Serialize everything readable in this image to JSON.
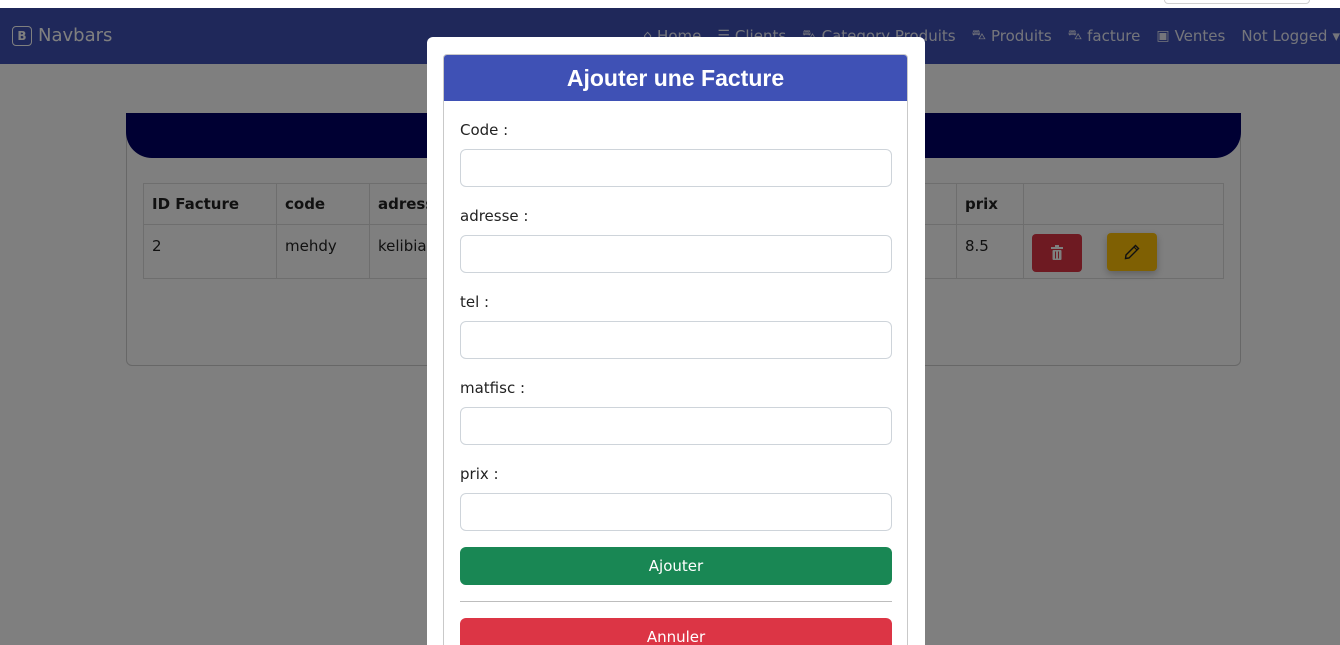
{
  "navbar": {
    "brand_icon": "B",
    "brand": "Navbars",
    "links": [
      {
        "icon": "house-icon",
        "glyph": "⌂",
        "label": "Home"
      },
      {
        "icon": "list-icon",
        "glyph": "☰",
        "label": "Clients"
      },
      {
        "icon": "basket-icon",
        "glyph": "⛍",
        "label": "Category Produits"
      },
      {
        "icon": "basket-icon",
        "glyph": "⛍",
        "label": "Produits"
      },
      {
        "icon": "basket-icon",
        "glyph": "⛍",
        "label": "facture"
      },
      {
        "icon": "cash-icon",
        "glyph": "▣",
        "label": "Ventes"
      },
      {
        "icon": "",
        "glyph": "",
        "label": "Not Logged"
      }
    ],
    "caret": "▾"
  },
  "table": {
    "headers": [
      "ID Facture",
      "code",
      "adresse",
      "",
      "",
      "prix",
      ""
    ],
    "rows": [
      {
        "id": "2",
        "code": "mehdy",
        "adresse": "kelibia",
        "prix": "8.5"
      }
    ]
  },
  "modal": {
    "title": "Ajouter une Facture",
    "fields": [
      {
        "label": "Code :",
        "value": "",
        "placeholder": ""
      },
      {
        "label": "adresse :",
        "value": "",
        "placeholder": ""
      },
      {
        "label": "tel :",
        "value": "",
        "placeholder": ""
      },
      {
        "label": "matfisc :",
        "value": "",
        "placeholder": ""
      },
      {
        "label": "prix :",
        "value": "",
        "placeholder": ""
      }
    ],
    "submit_label": "Ajouter",
    "cancel_label": "Annuler"
  },
  "colors": {
    "navbar": "#3f51b5",
    "card_header": "#000066",
    "success": "#198754",
    "danger": "#dc3545",
    "warning": "#ffc107"
  }
}
